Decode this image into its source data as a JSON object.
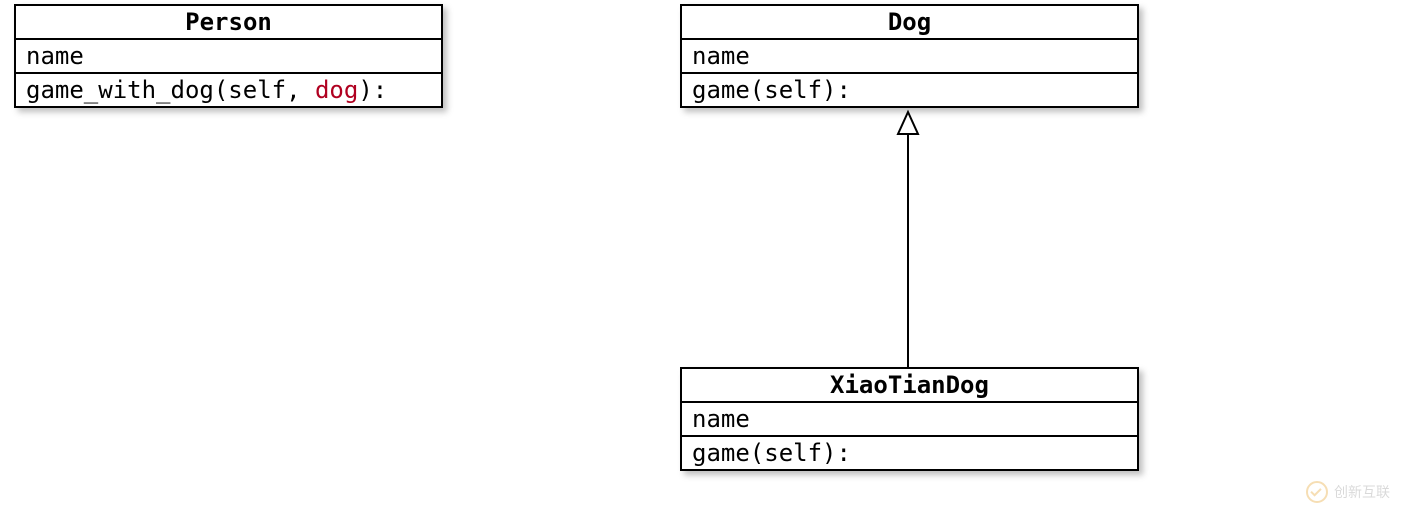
{
  "classes": {
    "person": {
      "title": "Person",
      "attr": "name",
      "method_prefix": "game_with_dog(self, ",
      "method_param": "dog",
      "method_suffix": "):"
    },
    "dog": {
      "title": "Dog",
      "attr": "name",
      "method": "game(self):"
    },
    "xiaotian": {
      "title": "XiaoTianDog",
      "attr": "name",
      "method": "game(self):"
    }
  },
  "watermark": "创新互联"
}
